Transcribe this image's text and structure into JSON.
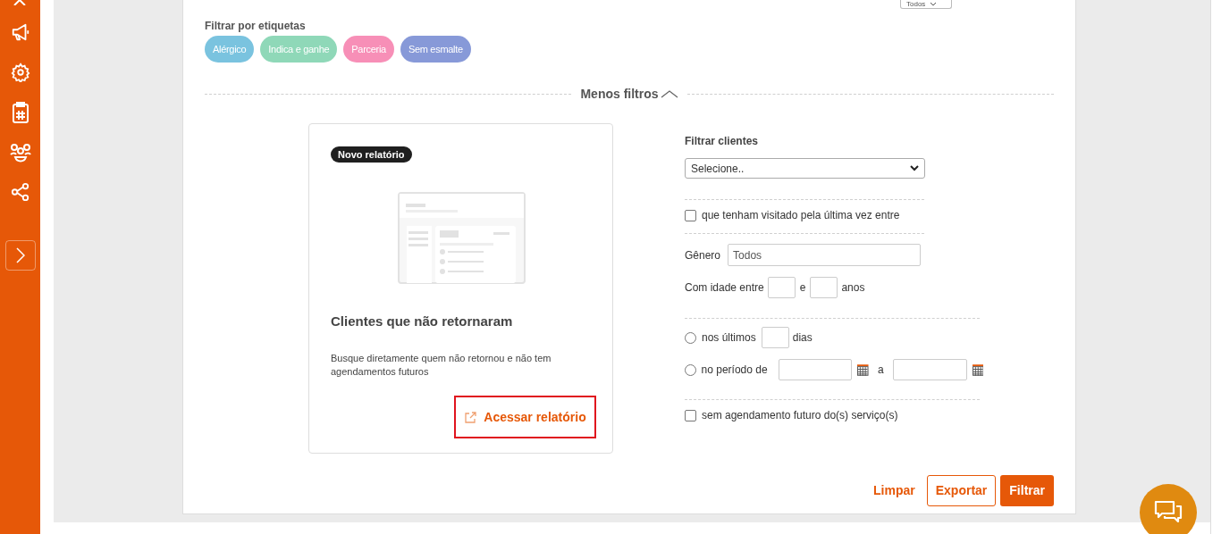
{
  "top_select": {
    "value": "Todos"
  },
  "tag_filter": {
    "label": "Filtrar por etiquetas",
    "tags": [
      {
        "label": "Alérgico",
        "color": "#7ac3df"
      },
      {
        "label": "Indica e ganhe",
        "color": "#8fd8b8"
      },
      {
        "label": "Parceria",
        "color": "#f78fb7"
      },
      {
        "label": "Sem esmalte",
        "color": "#8799d8"
      }
    ]
  },
  "filters_toggle": {
    "label": "Menos filtros",
    "expanded": true
  },
  "report_card": {
    "badge": "Novo relatório",
    "title": "Clientes que não retornaram",
    "description": "Busque diretamente quem não retornou e não tem agendamentos futuros",
    "link": "Acessar relatório"
  },
  "client_filter": {
    "label": "Filtrar clientes",
    "select_value": "Selecione.."
  },
  "visited_checkbox": {
    "label": "que tenham visitado pela última vez entre",
    "checked": false
  },
  "gender": {
    "label": "Gênero",
    "value": "Todos"
  },
  "age": {
    "label": "Com idade entre",
    "separator": "e",
    "suffix": "anos"
  },
  "period_options": [
    {
      "kind": "days",
      "label": "nos últimos",
      "suffix": "dias",
      "selected": false
    },
    {
      "kind": "range",
      "label": "no período de",
      "separator": "a",
      "selected": false
    }
  ],
  "future_checkbox": {
    "label": "sem agendamento futuro do(s) serviço(s)",
    "checked": false
  },
  "actions": [
    {
      "kind": "link",
      "label": "Limpar"
    },
    {
      "kind": "outline",
      "label": "Exportar"
    },
    {
      "kind": "primary",
      "label": "Filtrar"
    }
  ]
}
